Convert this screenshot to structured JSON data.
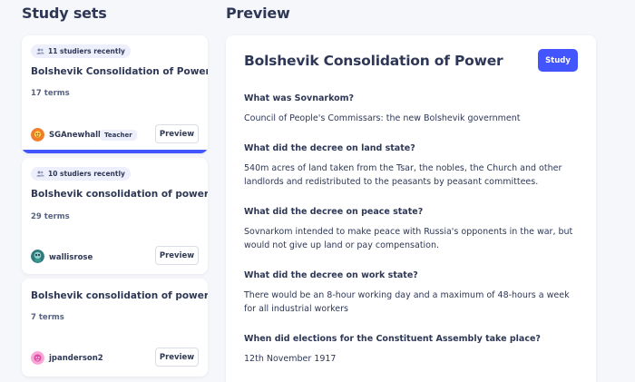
{
  "left": {
    "heading": "Study sets",
    "cards": [
      {
        "badge": "11 studiers recently",
        "title": "Bolshevik Consolidation of Power",
        "terms": "17 terms",
        "author": "SGAnewhall",
        "role": "Teacher",
        "preview_label": "Preview"
      },
      {
        "badge": "10 studiers recently",
        "title": "Bolshevik consolidation of power",
        "terms": "29 terms",
        "author": "wallisrose",
        "preview_label": "Preview"
      },
      {
        "title": "Bolshevik consolidation of power",
        "terms": "7 terms",
        "author": "jpanderson2",
        "preview_label": "Preview"
      }
    ]
  },
  "right": {
    "heading": "Preview",
    "title": "Bolshevik Consolidation of Power",
    "study_label": "Study",
    "items": [
      {
        "q": "What was Sovnarkom?",
        "a": "Council of People's Commissars: the new Bolshevik government"
      },
      {
        "q": "What did the decree on land state?",
        "a": "540m acres of land taken from the Tsar, the nobles, the Church and other landlords and redistributed to the peasants by peasant committees."
      },
      {
        "q": "What did the decree on peace state?",
        "a": "Sovnarkom intended to make peace with Russia's opponents in the war, but would not give up land or pay compensation."
      },
      {
        "q": "What did the decree on work state?",
        "a": "There would be an 8-hour working day and a maximum of 48-hours a week for all industrial workers"
      },
      {
        "q": "When did elections for the Constituent Assembly take place?",
        "a": "12th November 1917"
      }
    ]
  },
  "colors": {
    "accent": "#4255ff",
    "text": "#2e3856",
    "muted": "#586380",
    "page_bg": "#f6f7fb"
  },
  "icons": {
    "badge": "people-icon",
    "avatar_1": "avatar-icon",
    "avatar_2": "avatar-icon",
    "avatar_3": "avatar-icon"
  }
}
